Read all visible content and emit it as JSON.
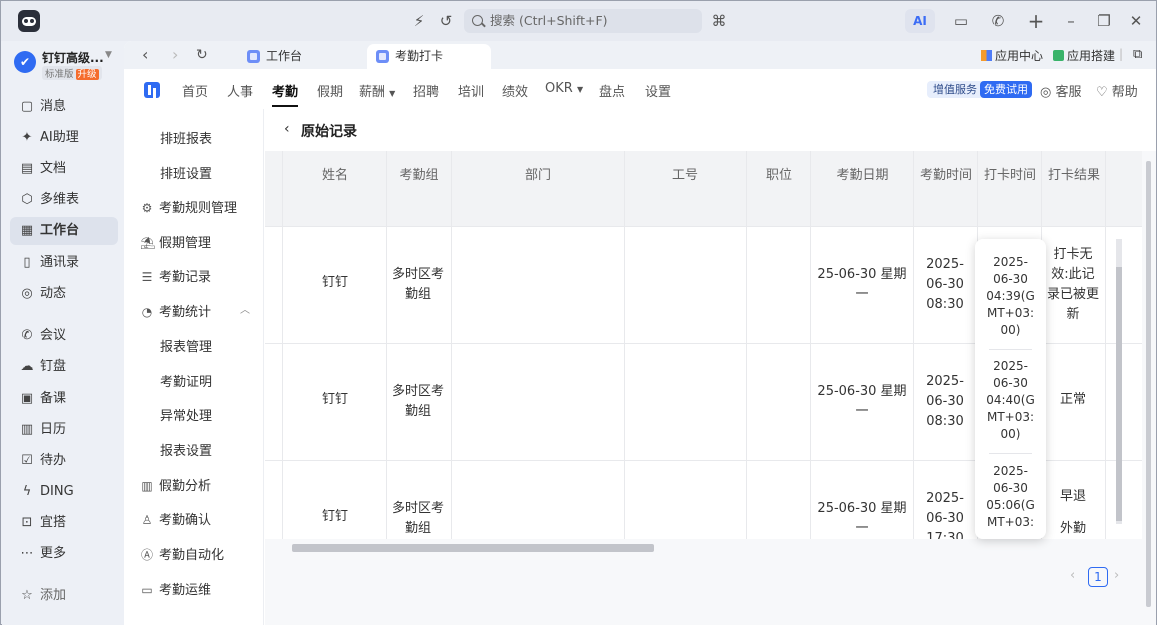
{
  "titlebar": {
    "search_placeholder": "搜索 (Ctrl+Shift+F)",
    "ai_label": "AI"
  },
  "org": {
    "name": "钉钉高级...",
    "edition": "标准版",
    "upgrade": "升级"
  },
  "sidebar": {
    "items": [
      {
        "label": "消息",
        "icon": "message-icon"
      },
      {
        "label": "AI助理",
        "icon": "ai-assistant-icon"
      },
      {
        "label": "文档",
        "icon": "document-icon"
      },
      {
        "label": "多维表",
        "icon": "multi-table-icon"
      },
      {
        "label": "工作台",
        "icon": "workbench-icon"
      },
      {
        "label": "通讯录",
        "icon": "contacts-icon"
      },
      {
        "label": "动态",
        "icon": "activity-icon"
      },
      {
        "label": "会议",
        "icon": "meeting-icon"
      },
      {
        "label": "钉盘",
        "icon": "drive-icon"
      },
      {
        "label": "备课",
        "icon": "lesson-prep-icon"
      },
      {
        "label": "日历",
        "icon": "calendar-icon"
      },
      {
        "label": "待办",
        "icon": "todo-icon"
      },
      {
        "label": "DING",
        "icon": "ding-icon"
      },
      {
        "label": "宜搭",
        "icon": "yida-icon"
      },
      {
        "label": "更多",
        "icon": "more-icon"
      },
      {
        "label": "添加",
        "icon": "pin-icon"
      }
    ],
    "active_index": 4
  },
  "tabs": [
    {
      "label": "工作台"
    },
    {
      "label": "考勤打卡"
    }
  ],
  "top_right": {
    "app_center": "应用中心",
    "app_builder": "应用搭建"
  },
  "topnav": {
    "items": [
      "首页",
      "人事",
      "考勤",
      "假期",
      "薪酬",
      "招聘",
      "培训",
      "绩效",
      "OKR",
      "盘点",
      "设置"
    ],
    "active": "考勤",
    "value_added": "增值服务",
    "free_trial": "免费试用",
    "service": "客服",
    "help": "帮助"
  },
  "subnav": {
    "items": [
      {
        "label": "排班报表",
        "level": 2
      },
      {
        "label": "排班设置",
        "level": 2
      },
      {
        "label": "考勤规则管理",
        "level": 1,
        "icon": "rules-icon"
      },
      {
        "label": "假期管理",
        "level": 1,
        "icon": "holiday-icon"
      },
      {
        "label": "考勤记录",
        "level": 1,
        "icon": "records-icon"
      },
      {
        "label": "考勤统计",
        "level": 1,
        "icon": "statistics-icon"
      },
      {
        "label": "报表管理",
        "level": 2
      },
      {
        "label": "考勤证明",
        "level": 2
      },
      {
        "label": "异常处理",
        "level": 2
      },
      {
        "label": "报表设置",
        "level": 2
      },
      {
        "label": "假勤分析",
        "level": 1,
        "icon": "analysis-icon"
      },
      {
        "label": "考勤确认",
        "level": 1,
        "icon": "confirm-icon"
      },
      {
        "label": "考勤自动化",
        "level": 1,
        "icon": "automation-icon"
      },
      {
        "label": "考勤运维",
        "level": 1,
        "icon": "ops-icon"
      }
    ]
  },
  "page": {
    "title": "原始记录"
  },
  "table": {
    "columns": [
      "姓名",
      "考勤组",
      "部门",
      "工号",
      "职位",
      "考勤日期",
      "考勤时间",
      "打卡时间",
      "打卡结果"
    ],
    "rows": [
      {
        "name": "钉钉",
        "group": "多时区考勤组",
        "dept": "",
        "emp_no": "",
        "position": "",
        "date": "25-06-30 星期一",
        "att_time": "2025-06-30 08:30",
        "punch_time": "2025-06-30 04:39(GMT+03:00)",
        "result": "打卡无效:此记录已被更新"
      },
      {
        "name": "钉钉",
        "group": "多时区考勤组",
        "dept": "",
        "emp_no": "",
        "position": "",
        "date": "25-06-30 星期一",
        "att_time": "2025-06-30 08:30",
        "punch_time": "2025-06-30 04:40(GMT+03:00)",
        "result": "正常"
      },
      {
        "name": "钉钉",
        "group": "多时区考勤组",
        "dept": "",
        "emp_no": "",
        "position": "",
        "date": "25-06-30 星期一",
        "att_time": "2025-06-30 17:30",
        "punch_time": "2025-06-30 05:06(GMT+03:",
        "result": "早退",
        "result_extra": "外勤"
      }
    ]
  },
  "tooltip": {
    "entries": [
      [
        "2025-",
        "06-30",
        "04:39(G",
        "MT+03:",
        "00)"
      ],
      [
        "2025-",
        "06-30",
        "04:40(G",
        "MT+03:",
        "00)"
      ],
      [
        "2025-",
        "06-30",
        "05:06(G",
        "MT+03:"
      ]
    ]
  },
  "pager": {
    "current": "1"
  }
}
